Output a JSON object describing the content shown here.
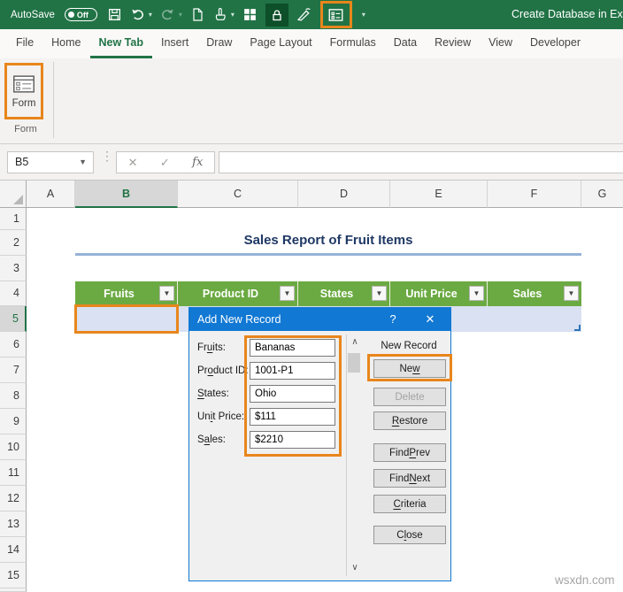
{
  "colors": {
    "excel_green": "#217346",
    "annotation_orange": "#e8861c",
    "dialog_blue": "#1178d4",
    "table_header_green": "#6baa42",
    "banded_row_blue": "#d9e1f2",
    "title_navy": "#1f3864",
    "title_underline_blue": "#95b3d7",
    "selected_header_green": "#217346"
  },
  "topbar": {
    "autosave_label": "AutoSave",
    "autosave_state": "Off",
    "document_title": "Create Database in Exce",
    "qat_icon_names": [
      "save-icon",
      "undo-icon",
      "redo-icon",
      "new-file-icon",
      "touch-mode-icon",
      "grid-icon",
      "lock-icon",
      "draw-icon",
      "form-icon",
      "more-commands-icon"
    ]
  },
  "ribbon": {
    "tabs": [
      {
        "label": "File"
      },
      {
        "label": "Home"
      },
      {
        "label": "New Tab"
      },
      {
        "label": "Insert"
      },
      {
        "label": "Draw"
      },
      {
        "label": "Page Layout"
      },
      {
        "label": "Formulas"
      },
      {
        "label": "Data"
      },
      {
        "label": "Review"
      },
      {
        "label": "View"
      },
      {
        "label": "Developer"
      }
    ],
    "active_tab": "New Tab",
    "form_button_label": "Form",
    "group_label": "Form"
  },
  "formula_bar": {
    "name_box_value": "B5",
    "formula_value": "",
    "function_label": "fx",
    "cancel_glyph": "✕",
    "enter_glyph": "✓"
  },
  "grid": {
    "column_headers": [
      "A",
      "B",
      "C",
      "D",
      "E",
      "F",
      "G"
    ],
    "selected_column": "B",
    "row_numbers": [
      "1",
      "2",
      "3",
      "4",
      "5",
      "6",
      "7",
      "8",
      "9",
      "10",
      "11",
      "12",
      "13",
      "14",
      "15"
    ],
    "selected_row": "5",
    "selected_cell": "B5"
  },
  "sheet": {
    "title": "Sales Report of Fruit Items",
    "table": {
      "headers": [
        "Fruits",
        "Product ID",
        "States",
        "Unit Price",
        "Sales"
      ],
      "new_row_values": {
        "Fruits": "",
        "Product ID": "",
        "States": "",
        "Unit Price": "",
        "Sales": ""
      }
    }
  },
  "dialog": {
    "title": "Add New Record",
    "help_glyph": "?",
    "close_glyph": "✕",
    "fields": [
      {
        "label": {
          "pre": "Fr",
          "key": "u",
          "post": "its:"
        },
        "value": "Bananas"
      },
      {
        "label": {
          "pre": "Pr",
          "key": "o",
          "post": "duct ID:"
        },
        "value": "1001-P1"
      },
      {
        "label": {
          "pre": "",
          "key": "S",
          "post": "tates:"
        },
        "value": "Ohio"
      },
      {
        "label": {
          "pre": "Un",
          "key": "i",
          "post": "t Price:"
        },
        "value": "$111"
      },
      {
        "label": {
          "pre": "S",
          "key": "a",
          "post": "les:"
        },
        "value": "$2210"
      }
    ],
    "side_label": "New Record",
    "buttons": [
      {
        "label": {
          "pre": "Ne",
          "key": "w",
          "post": ""
        },
        "disabled": false
      },
      {
        "label": {
          "pre": "Delete",
          "key": "",
          "post": ""
        },
        "disabled": true
      },
      {
        "label": {
          "pre": "",
          "key": "R",
          "post": "estore"
        },
        "disabled": false
      },
      {
        "label": {
          "pre": "Find ",
          "key": "P",
          "post": "rev"
        },
        "disabled": false
      },
      {
        "label": {
          "pre": "Find ",
          "key": "N",
          "post": "ext"
        },
        "disabled": false
      },
      {
        "label": {
          "pre": "",
          "key": "C",
          "post": "riteria"
        },
        "disabled": false
      },
      {
        "label": {
          "pre": "C",
          "key": "l",
          "post": "ose"
        },
        "disabled": false
      }
    ],
    "scroll_up_glyph": "∧",
    "scroll_down_glyph": "∨"
  },
  "watermark": "wsxdn.com"
}
